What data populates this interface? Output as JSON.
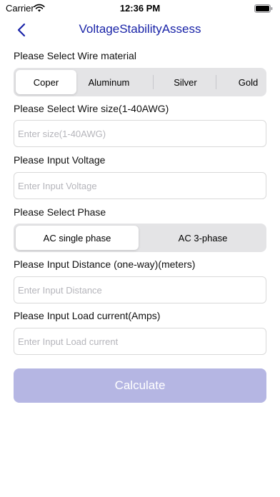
{
  "status_bar": {
    "carrier": "Carrier",
    "time": "12:36 PM"
  },
  "nav": {
    "title": "VoltageStabilityAssess"
  },
  "wire_material": {
    "label": "Please Select Wire material",
    "options": [
      "Coper",
      "Aluminum",
      "Silver",
      "Gold"
    ],
    "selected": "Coper"
  },
  "wire_size": {
    "label": "Please Select Wire size(1-40AWG)",
    "placeholder": "Enter size(1-40AWG)"
  },
  "voltage": {
    "label": "Please Input Voltage",
    "placeholder": "Enter Input Voltage"
  },
  "phase": {
    "label": "Please Select Phase",
    "options": [
      "AC single phase",
      "AC 3-phase"
    ],
    "selected": "AC single phase"
  },
  "distance": {
    "label": "Please Input Distance (one-way)(meters)",
    "placeholder": "Enter Input Distance"
  },
  "load_current": {
    "label": "Please Input Load current(Amps)",
    "placeholder": "Enter Input Load current"
  },
  "calculate": {
    "label": "Calculate",
    "color": "#b5b6e3"
  },
  "colors": {
    "accent": "#1a24a8"
  }
}
